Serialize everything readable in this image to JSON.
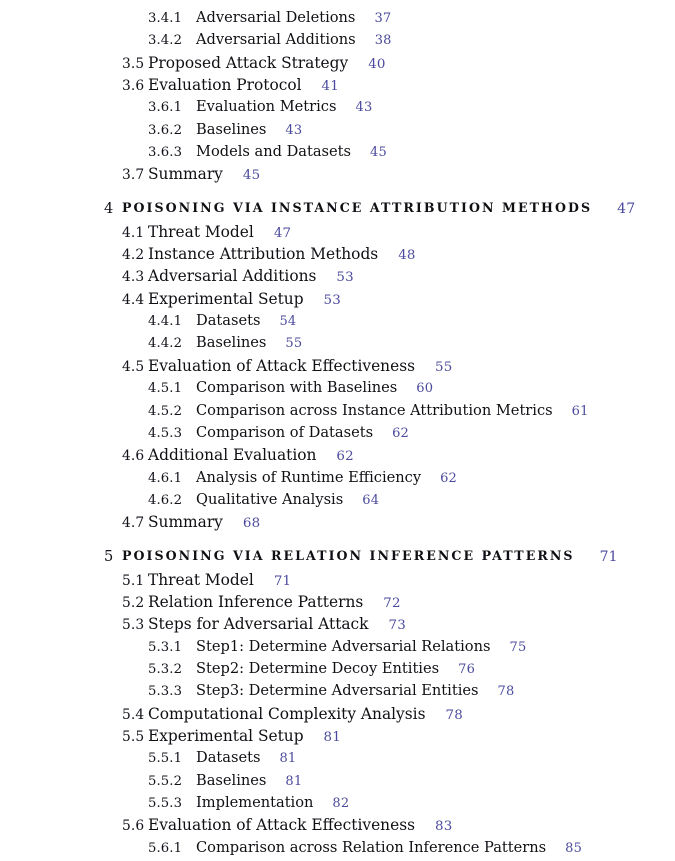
{
  "document": {
    "kind": "table-of-contents",
    "colors": {
      "page_background": "#ffffff",
      "body_text": "#100f14",
      "page_number": "#4b4a9c",
      "section_number": "#13121a"
    }
  },
  "entries": [
    {
      "level": 2,
      "number": "3.4.1",
      "title": "Adversarial Deletions",
      "page": "37"
    },
    {
      "level": 2,
      "number": "3.4.2",
      "title": "Adversarial Additions",
      "page": "38"
    },
    {
      "level": 1,
      "number": "3.5",
      "title": "Proposed Attack Strategy",
      "page": "40"
    },
    {
      "level": 1,
      "number": "3.6",
      "title": "Evaluation Protocol",
      "page": "41"
    },
    {
      "level": 2,
      "number": "3.6.1",
      "title": "Evaluation Metrics",
      "page": "43"
    },
    {
      "level": 2,
      "number": "3.6.2",
      "title": "Baselines",
      "page": "43"
    },
    {
      "level": 2,
      "number": "3.6.3",
      "title": "Models and Datasets",
      "page": "45"
    },
    {
      "level": 1,
      "number": "3.7",
      "title": "Summary",
      "page": "45"
    },
    {
      "level": 0,
      "number": "4",
      "title": "Poisoning via Instance Attribution Methods",
      "page": "47"
    },
    {
      "level": 1,
      "number": "4.1",
      "title": "Threat Model",
      "page": "47"
    },
    {
      "level": 1,
      "number": "4.2",
      "title": "Instance Attribution Methods",
      "page": "48"
    },
    {
      "level": 1,
      "number": "4.3",
      "title": "Adversarial Additions",
      "page": "53"
    },
    {
      "level": 1,
      "number": "4.4",
      "title": "Experimental Setup",
      "page": "53"
    },
    {
      "level": 2,
      "number": "4.4.1",
      "title": "Datasets",
      "page": "54"
    },
    {
      "level": 2,
      "number": "4.4.2",
      "title": "Baselines",
      "page": "55"
    },
    {
      "level": 1,
      "number": "4.5",
      "title": "Evaluation of Attack Effectiveness",
      "page": "55"
    },
    {
      "level": 2,
      "number": "4.5.1",
      "title": "Comparison with Baselines",
      "page": "60"
    },
    {
      "level": 2,
      "number": "4.5.2",
      "title": "Comparison across Instance Attribution Metrics",
      "page": "61"
    },
    {
      "level": 2,
      "number": "4.5.3",
      "title": "Comparison of Datasets",
      "page": "62"
    },
    {
      "level": 1,
      "number": "4.6",
      "title": "Additional Evaluation",
      "page": "62"
    },
    {
      "level": 2,
      "number": "4.6.1",
      "title": "Analysis of Runtime Efficiency",
      "page": "62"
    },
    {
      "level": 2,
      "number": "4.6.2",
      "title": "Qualitative Analysis",
      "page": "64"
    },
    {
      "level": 1,
      "number": "4.7",
      "title": "Summary",
      "page": "68"
    },
    {
      "level": 0,
      "number": "5",
      "title": "Poisoning via Relation Inference Patterns",
      "page": "71"
    },
    {
      "level": 1,
      "number": "5.1",
      "title": "Threat Model",
      "page": "71"
    },
    {
      "level": 1,
      "number": "5.2",
      "title": "Relation Inference Patterns",
      "page": "72"
    },
    {
      "level": 1,
      "number": "5.3",
      "title": "Steps for Adversarial Attack",
      "page": "73"
    },
    {
      "level": 2,
      "number": "5.3.1",
      "title": "Step1: Determine Adversarial Relations",
      "page": "75"
    },
    {
      "level": 2,
      "number": "5.3.2",
      "title": "Step2: Determine Decoy Entities",
      "page": "76"
    },
    {
      "level": 2,
      "number": "5.3.3",
      "title": "Step3: Determine Adversarial Entities",
      "page": "78"
    },
    {
      "level": 1,
      "number": "5.4",
      "title": "Computational Complexity Analysis",
      "page": "78"
    },
    {
      "level": 1,
      "number": "5.5",
      "title": "Experimental Setup",
      "page": "81"
    },
    {
      "level": 2,
      "number": "5.5.1",
      "title": "Datasets",
      "page": "81"
    },
    {
      "level": 2,
      "number": "5.5.2",
      "title": "Baselines",
      "page": "81"
    },
    {
      "level": 2,
      "number": "5.5.3",
      "title": "Implementation",
      "page": "82"
    },
    {
      "level": 1,
      "number": "5.6",
      "title": "Evaluation of Attack Effectiveness",
      "page": "83"
    },
    {
      "level": 2,
      "number": "5.6.1",
      "title": "Comparison across Relation Inference Patterns",
      "page": "85"
    }
  ]
}
